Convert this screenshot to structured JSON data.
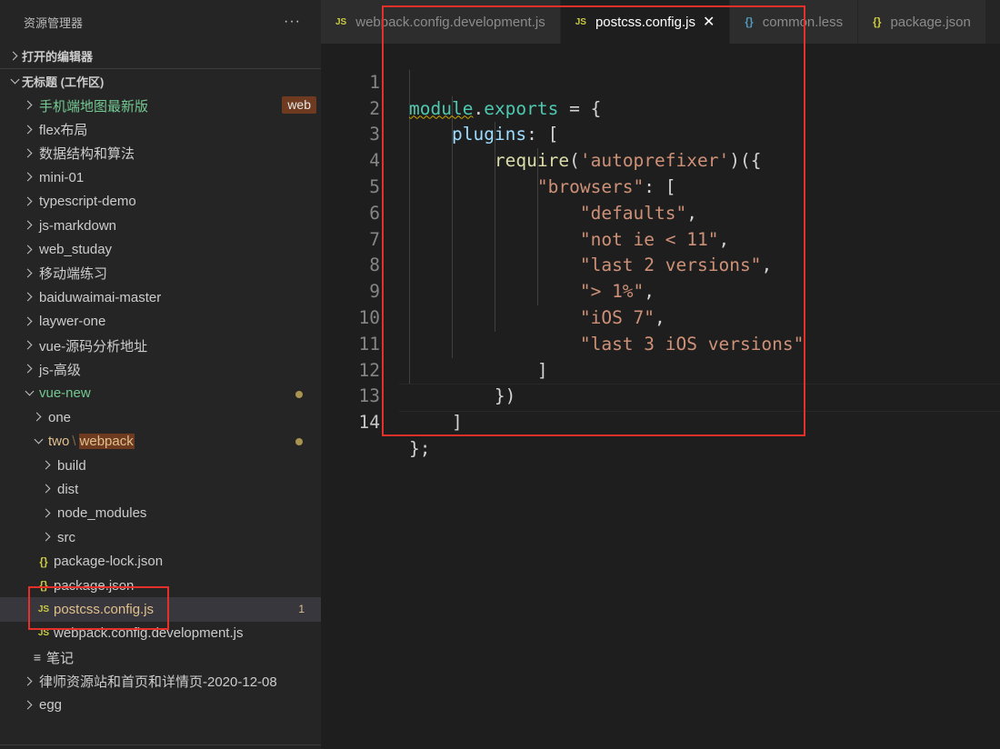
{
  "explorer": {
    "title": "资源管理器",
    "more": "···",
    "open_editors": "打开的编辑器",
    "workspace": "无标题 (工作区)",
    "tree": [
      {
        "label": "手机端地图最新版",
        "expanded": false,
        "style": "green",
        "badge": "web"
      },
      {
        "label": "flex布局",
        "expanded": false
      },
      {
        "label": "数据结构和算法",
        "expanded": false
      },
      {
        "label": "mini-01",
        "expanded": false
      },
      {
        "label": "typescript-demo",
        "expanded": false
      },
      {
        "label": "js-markdown",
        "expanded": false
      },
      {
        "label": "web_studay",
        "expanded": false
      },
      {
        "label": "移动端练习",
        "expanded": false
      },
      {
        "label": "baiduwaimai-master",
        "expanded": false
      },
      {
        "label": "laywer-one",
        "expanded": false
      },
      {
        "label": "vue-源码分析地址",
        "expanded": false
      },
      {
        "label": "js-高级",
        "expanded": false
      },
      {
        "label": "vue-new",
        "expanded": true,
        "style": "green",
        "dot": true
      },
      {
        "label": "one",
        "expanded": false
      },
      {
        "label_a": "two",
        "label_b": "webpack",
        "expanded": true,
        "style": "mod",
        "dot": true
      },
      {
        "label": "build",
        "expanded": false
      },
      {
        "label": "dist",
        "expanded": false
      },
      {
        "label": "node_modules",
        "expanded": false
      },
      {
        "label": "src",
        "expanded": false
      },
      {
        "label": "package-lock.json",
        "file": "json"
      },
      {
        "label": "package.json",
        "file": "json"
      },
      {
        "label": "postcss.config.js",
        "file": "js",
        "count": "1",
        "style": "mod",
        "selected": true
      },
      {
        "label": "webpack.config.development.js",
        "file": "js"
      },
      {
        "label": "笔记",
        "file": "md"
      },
      {
        "label": "律师资源站和首页和详情页-2020-12-08",
        "expanded": false
      },
      {
        "label": "egg",
        "expanded": false
      }
    ]
  },
  "tabs": [
    {
      "icon": "JS",
      "label": "webpack.config.development.js",
      "active": false
    },
    {
      "icon": "JS",
      "label": "postcss.config.js",
      "active": true,
      "close": "✕"
    },
    {
      "icon": "{}",
      "label": "common.less",
      "active": false
    },
    {
      "icon": "{}",
      "label": "package.json",
      "active": false
    }
  ],
  "editor": {
    "current_line": 14,
    "lines": [
      {
        "n": "1",
        "text": "module.exports = {"
      },
      {
        "n": "2",
        "text": "    plugins: ["
      },
      {
        "n": "3",
        "text": "        require('autoprefixer')({"
      },
      {
        "n": "4",
        "text": "            \"browsers\": ["
      },
      {
        "n": "5",
        "text": "                \"defaults\","
      },
      {
        "n": "6",
        "text": "                \"not ie < 11\","
      },
      {
        "n": "7",
        "text": "                \"last 2 versions\","
      },
      {
        "n": "8",
        "text": "                \"> 1%\","
      },
      {
        "n": "9",
        "text": "                \"iOS 7\","
      },
      {
        "n": "10",
        "text": "                \"last 3 iOS versions\""
      },
      {
        "n": "11",
        "text": "            ]"
      },
      {
        "n": "12",
        "text": "        })"
      },
      {
        "n": "13",
        "text": "    ]"
      },
      {
        "n": "14",
        "text": "};"
      }
    ]
  },
  "colors": {
    "accent_red": "#e5302a",
    "modified": "#e2c08d",
    "added": "#73c991",
    "js_icon": "#cbcb41"
  }
}
